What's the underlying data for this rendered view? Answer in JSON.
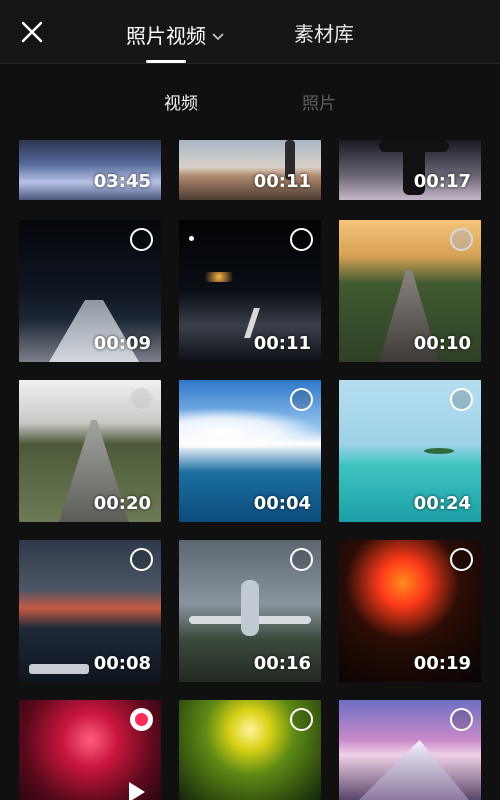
{
  "header": {
    "close_icon": "close-icon",
    "tabs": [
      {
        "label": "照片视频",
        "active": true,
        "has_dropdown": true
      },
      {
        "label": "素材库",
        "active": false
      }
    ]
  },
  "subtabs": [
    {
      "label": "视频",
      "active": true
    },
    {
      "label": "照片",
      "active": false
    }
  ],
  "grid": {
    "items": [
      {
        "duration": "03:45",
        "thumb": "snowy-mountain",
        "selected": false
      },
      {
        "duration": "00:11",
        "thumb": "beach-person",
        "selected": false
      },
      {
        "duration": "00:17",
        "thumb": "silhouette-arms",
        "selected": false
      },
      {
        "duration": "00:09",
        "thumb": "night-highway",
        "selected": false
      },
      {
        "duration": "00:11",
        "thumb": "night-road",
        "selected": false
      },
      {
        "duration": "00:10",
        "thumb": "sunset-highway",
        "selected": false
      },
      {
        "duration": "00:20",
        "thumb": "rural-road",
        "selected": false
      },
      {
        "duration": "00:04",
        "thumb": "sea-clouds",
        "selected": false
      },
      {
        "duration": "00:24",
        "thumb": "lagoon-island",
        "selected": false
      },
      {
        "duration": "00:08",
        "thumb": "dusk-airport",
        "selected": false
      },
      {
        "duration": "00:16",
        "thumb": "airplane-landing",
        "selected": false
      },
      {
        "duration": "00:19",
        "thumb": "fireworks",
        "selected": false
      },
      {
        "duration": "",
        "thumb": "red-fireworks",
        "selected": true
      },
      {
        "duration": "",
        "thumb": "concert-lights",
        "selected": false
      },
      {
        "duration": "",
        "thumb": "pink-mountain",
        "selected": false
      }
    ]
  },
  "colors": {
    "background": "#101010",
    "header_bg": "#161616",
    "selected_dot": "#ff2d55",
    "inactive_tab": "#5e5e5e"
  }
}
